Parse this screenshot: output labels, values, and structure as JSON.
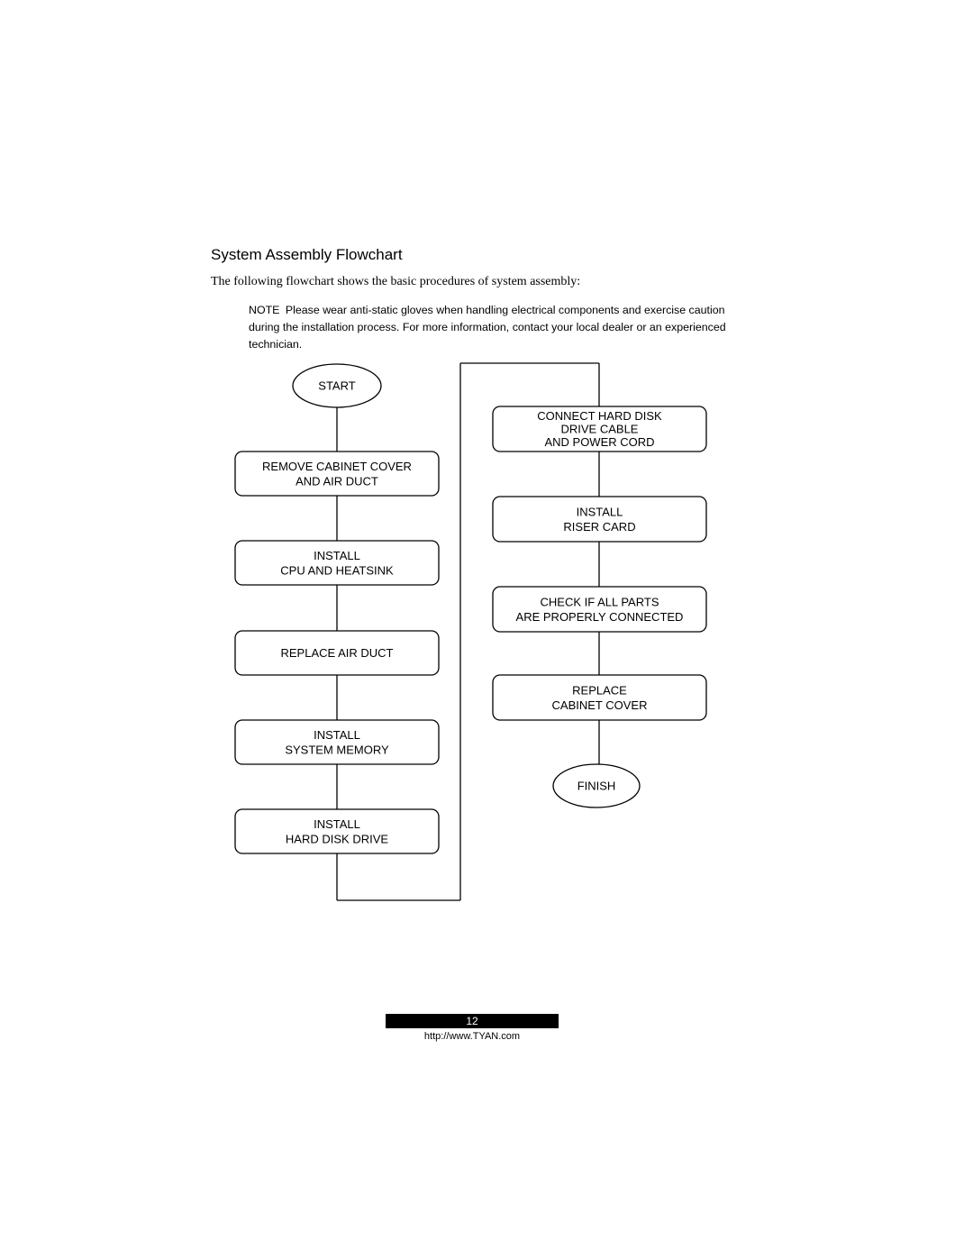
{
  "section": {
    "title": "System Assembly Flowchart",
    "intro": "The following flowchart shows the basic procedures of system assembly:",
    "note_label": "NOTE",
    "note_text": "Please wear anti-static gloves when handling electrical components and exercise caution during the installation process. For more information, contact your local dealer or an experienced technician."
  },
  "flowchart": {
    "start": "START",
    "finish": "FINISH",
    "left_steps": [
      [
        "REMOVE CABINET COVER",
        "AND AIR DUCT"
      ],
      [
        "INSTALL",
        "CPU AND HEATSINK"
      ],
      [
        "REPLACE AIR DUCT"
      ],
      [
        "INSTALL",
        "SYSTEM MEMORY"
      ],
      [
        "INSTALL",
        "HARD DISK DRIVE"
      ]
    ],
    "right_steps": [
      [
        "CONNECT HARD DISK",
        "DRIVE CABLE",
        "AND POWER CORD"
      ],
      [
        "INSTALL",
        "RISER CARD"
      ],
      [
        "CHECK IF ALL PARTS",
        "ARE PROPERLY CONNECTED"
      ],
      [
        "REPLACE",
        "CABINET COVER"
      ]
    ]
  },
  "footer": {
    "page_number": "12",
    "url": "http://www.TYAN.com"
  }
}
